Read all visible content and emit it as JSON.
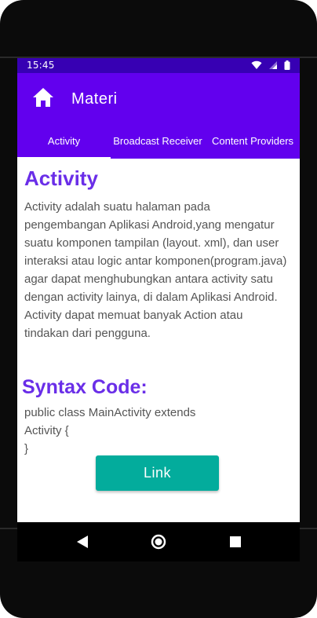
{
  "status_bar": {
    "time": "15:45",
    "icons": [
      "wifi-icon",
      "cellular-icon",
      "battery-icon"
    ],
    "color": "#3700b3"
  },
  "app_bar": {
    "title": "Materi",
    "home_icon": "home-icon",
    "color": "#6200ee"
  },
  "tabs": [
    {
      "label": "Activity",
      "active": true
    },
    {
      "label": "Broadcast Receiver",
      "active": false
    },
    {
      "label": "Content Providers",
      "active": false
    }
  ],
  "content": {
    "heading": "Activity",
    "body": "Activity adalah suatu halaman pada pengembangan Aplikasi Android,yang mengatur suatu komponen tampilan (layout. xml), dan user interaksi atau logic antar komponen(program.java)   agar dapat menghubungkan  antara activity satu dengan activity lainya, di dalam Aplikasi Android. Activity dapat memuat banyak Action atau tindakan dari pengguna.",
    "syntax_heading": "Syntax Code:",
    "code_lines": [
      "public class MainActivity extends",
      "Activity {",
      "}"
    ],
    "link_label": "Link",
    "accent_color": "#6a2ee8",
    "button_color": "#03ac9c"
  },
  "nav_bar": {
    "buttons": [
      "back-icon",
      "home-circle-icon",
      "recents-icon"
    ]
  }
}
